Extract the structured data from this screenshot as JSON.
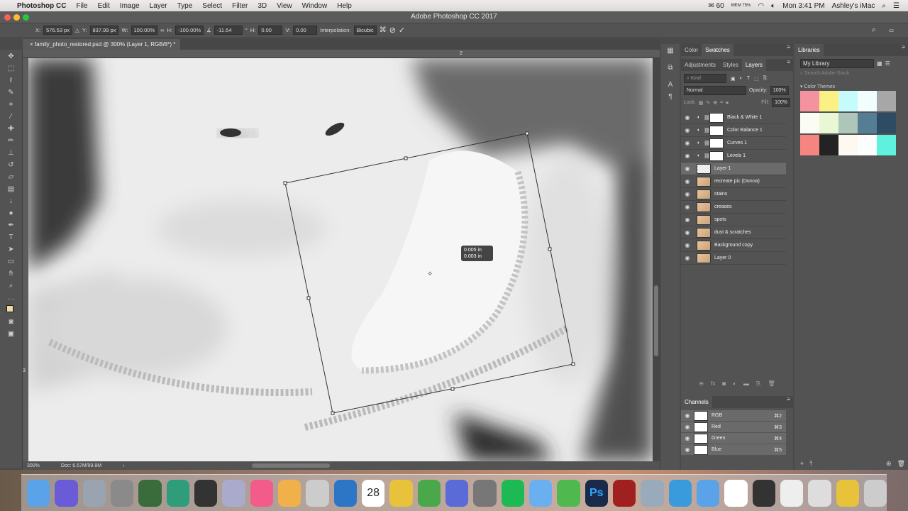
{
  "menubar": {
    "apple": "",
    "app": "Photoshop CC",
    "items": [
      "File",
      "Edit",
      "Image",
      "Layer",
      "Type",
      "Select",
      "Filter",
      "3D",
      "View",
      "Window",
      "Help"
    ],
    "status": {
      "mail_count": "60",
      "mem": "MEM 75%",
      "clock": "Mon 3:41 PM",
      "user": "Ashley's iMac"
    }
  },
  "window": {
    "title": "Adobe Photoshop CC 2017"
  },
  "options": {
    "x_label": "X:",
    "x": "576.53 px",
    "y_label": "Y:",
    "y": "837.99 px",
    "w_label": "W:",
    "w": "100.00%",
    "h_label": "H:",
    "h": "-100.00%",
    "angle": "-11.54",
    "deg": "°",
    "hskew_label": "H:",
    "hskew": "0.00",
    "vskew_label": "V:",
    "vskew": "0.00",
    "interp_label": "Interpolation:",
    "interp": "Bicubic"
  },
  "document": {
    "tab": "family_photo_restored.psd @ 300% (Layer 1, RGB/8*) *",
    "ruler_mark": "2",
    "ruler_left": "3",
    "tooltip_x": "0.005 in",
    "tooltip_y": "0.003 in"
  },
  "status": {
    "zoom": "300%",
    "doc": "Doc: 6.57M/99.8M"
  },
  "panels": {
    "top_tabs": [
      "Color",
      "Swatches"
    ],
    "tabs": [
      "Adjustments",
      "Styles",
      "Layers"
    ],
    "kind": "Kind",
    "blend": "Normal",
    "opacity_label": "Opacity:",
    "opacity": "100%",
    "lock_label": "Lock:",
    "fill_label": "Fill:",
    "fill": "100%",
    "layers": [
      {
        "name": "Black & White 1",
        "type": "adjustment"
      },
      {
        "name": "Color Balance 1",
        "type": "adjustment"
      },
      {
        "name": "Curves 1",
        "type": "adjustment"
      },
      {
        "name": "Levels 1",
        "type": "adjustment"
      },
      {
        "name": "Layer 1",
        "type": "transparent",
        "selected": true
      },
      {
        "name": "recreate pic (Donna)",
        "type": "photo"
      },
      {
        "name": "stains",
        "type": "photo"
      },
      {
        "name": "creases",
        "type": "photo"
      },
      {
        "name": "spots",
        "type": "photo"
      },
      {
        "name": "dust & scratches",
        "type": "photo"
      },
      {
        "name": "Background copy",
        "type": "photo"
      },
      {
        "name": "Layer 0",
        "type": "photo"
      }
    ],
    "channels_title": "Channels",
    "channels": [
      {
        "name": "RGB",
        "shortcut": "⌘2"
      },
      {
        "name": "Red",
        "shortcut": "⌘3"
      },
      {
        "name": "Green",
        "shortcut": "⌘4"
      },
      {
        "name": "Blue",
        "shortcut": "⌘5"
      }
    ]
  },
  "libraries": {
    "title": "Libraries",
    "library": "My Library",
    "search_placeholder": "Search Adobe Stock",
    "themes_label": "Color Themes",
    "themes": [
      [
        "#f4929f",
        "#fbf083",
        "#c6fbfc",
        "#f2fdfe",
        "#a7a7a7"
      ],
      [
        "#fbfdf5",
        "#eaf7d4",
        "#aec6b9",
        "#557d93",
        "#2d4b63"
      ],
      [
        "#f58581",
        "#222322",
        "#fdf8f0",
        "#fcfdfd",
        "#5ef1de"
      ]
    ]
  },
  "dock": {
    "icons": [
      "finder-icon",
      "siri-icon",
      "launchpad-icon",
      "system-preferences-icon",
      "photo-booth-icon",
      "time-machine-icon",
      "dashboard-icon",
      "preview-icon",
      "itunes-icon",
      "photos-icon",
      "scanner-icon",
      "1password-icon",
      "calendar-icon",
      "chrome-icon",
      "keynote-icon",
      "cube-icon",
      "font-icon",
      "spotify-icon",
      "mail-icon",
      "camtasia-icon",
      "photoshop-icon",
      "acrobat-icon",
      "files-icon",
      "app-store-icon",
      "folder-icon",
      "document-icon",
      "screen-icon",
      "doc2-icon",
      "window-icon",
      "chrome2-icon",
      "trash-icon"
    ],
    "colors": [
      "#5aa3e8",
      "#6b5bd6",
      "#9aa4b0",
      "#8a8a8a",
      "#3a6b3a",
      "#2f9c7a",
      "#333",
      "#aac",
      "#f35b8a",
      "#f0b04a",
      "#ccc",
      "#2d76c6",
      "#fff",
      "#e8c23a",
      "#4aa84a",
      "#5a6ad6",
      "#777",
      "#1db954",
      "#6ab0f0",
      "#4fb84f",
      "#1a2a4a",
      "#a02020",
      "#9ab",
      "#3a9bdc",
      "#5aa3e8",
      "#fff",
      "#333",
      "#eee",
      "#ddd",
      "#e8c23a",
      "#ccc"
    ],
    "calendar": "28"
  }
}
